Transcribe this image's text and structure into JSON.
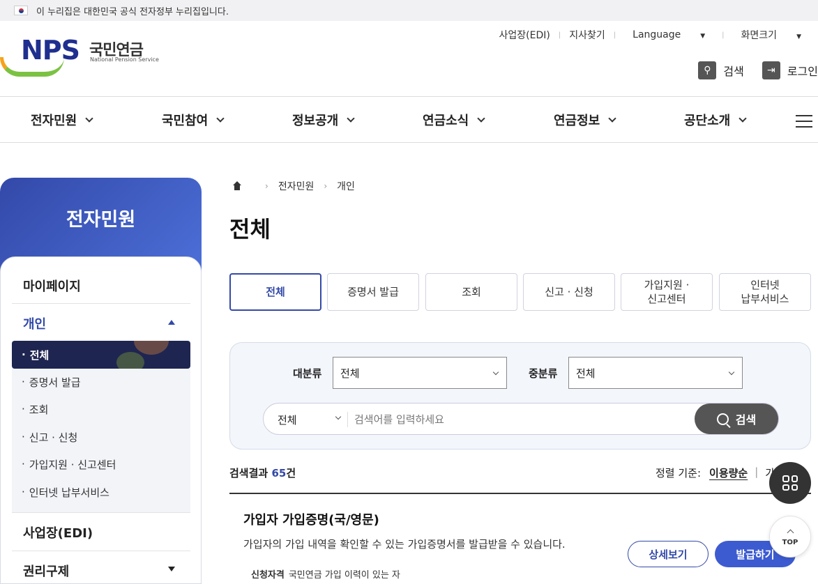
{
  "gov_banner": {
    "text": "이 누리집은 대한민국 공식 전자정부 누리집입니다."
  },
  "logo": {
    "mark": "NPS",
    "name_ko": "국민연금",
    "name_en": "National Pension Service"
  },
  "util_links": [
    "사업장(EDI)",
    "지사찾기",
    "Language",
    "화면크기"
  ],
  "header_actions": {
    "search": "검색",
    "login": "로그인"
  },
  "gnb": [
    "전자민원",
    "국민참여",
    "정보공개",
    "연금소식",
    "연금정보",
    "공단소개"
  ],
  "lnb": {
    "title": "전자민원",
    "mypage": "마이페이지",
    "current_group": "개인",
    "sub_items": [
      "전체",
      "증명서 발급",
      "조회",
      "신고 · 신청",
      "가입지원 · 신고센터",
      "인터넷 납부서비스"
    ],
    "edi": "사업장(EDI)",
    "rights": "권리구제"
  },
  "breadcrumb": [
    "전자민원",
    "개인"
  ],
  "page_title": "전체",
  "tabs": [
    {
      "label": "전체",
      "active": true
    },
    {
      "label": "증명서 발급"
    },
    {
      "label": "조회"
    },
    {
      "label": "신고 · 신청"
    },
    {
      "label": "가입지원 ·\n신고센터"
    },
    {
      "label": "인터넷\n납부서비스"
    }
  ],
  "search": {
    "major_label": "대분류",
    "major_value": "전체",
    "minor_label": "중분류",
    "minor_value": "전체",
    "scope_value": "전체",
    "placeholder": "검색어를 입력하세요",
    "button": "검색"
  },
  "results": {
    "prefix": "검색결과",
    "count": "65",
    "suffix": "건",
    "sort_label": "정렬 기준:",
    "sort_active": "이용량순",
    "sort_other": "가나다순"
  },
  "item": {
    "title": "가입자 가입증명(국/영문)",
    "desc": "가입자의 가입 내역을 확인할 수 있는 가입증명서를 발급받을 수 있습니다.",
    "meta_label": "신청자격",
    "meta_value": "국민연금 가입 이력이 있는 자",
    "detail_button": "상세보기",
    "issue_button": "발급하기"
  },
  "fab": {
    "top_label": "TOP"
  },
  "colors": {
    "accent": "#3349a9",
    "issue_button": "#3d5bd1",
    "lnb_active": "#1f2551"
  }
}
